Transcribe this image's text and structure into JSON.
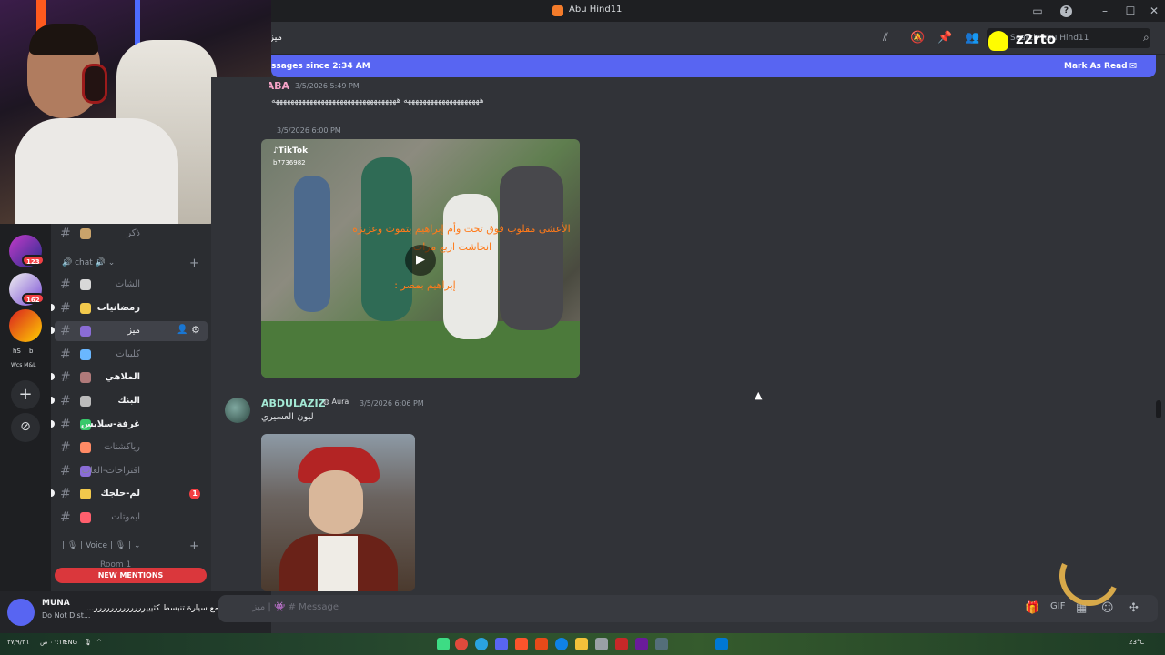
{
  "window": {
    "title": "Abu Hind11",
    "controls": [
      "inbox-icon",
      "help-icon",
      "minimize-icon",
      "maximize-icon",
      "close-icon"
    ]
  },
  "header": {
    "channel_name": "ميز",
    "search_placeholder": "Search Abu Hind11",
    "icons": [
      "threads-icon",
      "mute-icon",
      "pin-icon",
      "members-icon",
      "search-icon"
    ]
  },
  "new_messages_bar": {
    "text": "ssages since 2:34 AM",
    "action": "Mark As Read"
  },
  "rail": {
    "badges": [
      "123",
      "162"
    ],
    "labels": [
      "hS",
      "b",
      "Wcs M&L"
    ]
  },
  "sidebar": {
    "top_channel": "ذكر",
    "category_chat": "chat",
    "channels": [
      {
        "name": "الشات",
        "style": "muted"
      },
      {
        "name": "رمضانيات",
        "style": "unread"
      },
      {
        "name": "ميز",
        "style": "active"
      },
      {
        "name": "كليبات",
        "style": "muted"
      },
      {
        "name": "الملاهي",
        "style": "unread"
      },
      {
        "name": "البنك",
        "style": "unread"
      },
      {
        "name": "غرفة-سلايس",
        "style": "unread"
      },
      {
        "name": "رياكشنات",
        "style": "muted"
      },
      {
        "name": "اقتراحات-العاب",
        "style": "muted"
      },
      {
        "name": "لم-حلجك",
        "style": "unread",
        "badge": "1"
      },
      {
        "name": "ايموتات",
        "style": "muted"
      }
    ],
    "category_voice": "Voice",
    "voice_room": "Room 1",
    "new_mentions": "NEW MENTIONS"
  },
  "user_panel": {
    "name": "MUNA",
    "status": "Do Not Dist..."
  },
  "messages": [
    {
      "author": "ABA",
      "author_color": "#f5a3c7",
      "time": "3/5/2026 5:49 PM",
      "text": "ههههههههههههههههههههه هههههههههههههههههههههههههههههههههه"
    },
    {
      "time": "3/5/2026 6:00 PM",
      "video": {
        "source": "TikTok",
        "handle": "b7736982",
        "caption_line1": "الأعشى مقلوب فوق تحت وأم إبراهيم بتموت وعزيزه",
        "caption_line2": "انحاشت اربع مرات",
        "caption_line3": "إبراهيم بمصر :"
      }
    },
    {
      "author": "ABDULAZIZ",
      "author_color": "#a3e8d4",
      "tag": "Aura",
      "time": "3/5/2026 6:06 PM",
      "text": "ليون العسيري"
    }
  ],
  "composer": {
    "placeholder": "Message # 👾 | ميز"
  },
  "overlay": {
    "snap_name": "z2rto",
    "chat_ticker": "ارسمي امهند مع سيارة تنبسط كثيييررررررررررررر..."
  },
  "taskbar": {
    "language": "ENG",
    "time": "٠٦:١٣ ص",
    "date": "٢٧/٩/٢٦",
    "weather": "23°C"
  },
  "colors": {
    "accent": "#5865f2",
    "danger": "#da373c",
    "background": "#313338",
    "sidebar": "#2b2d31",
    "rail": "#1e1f22"
  }
}
